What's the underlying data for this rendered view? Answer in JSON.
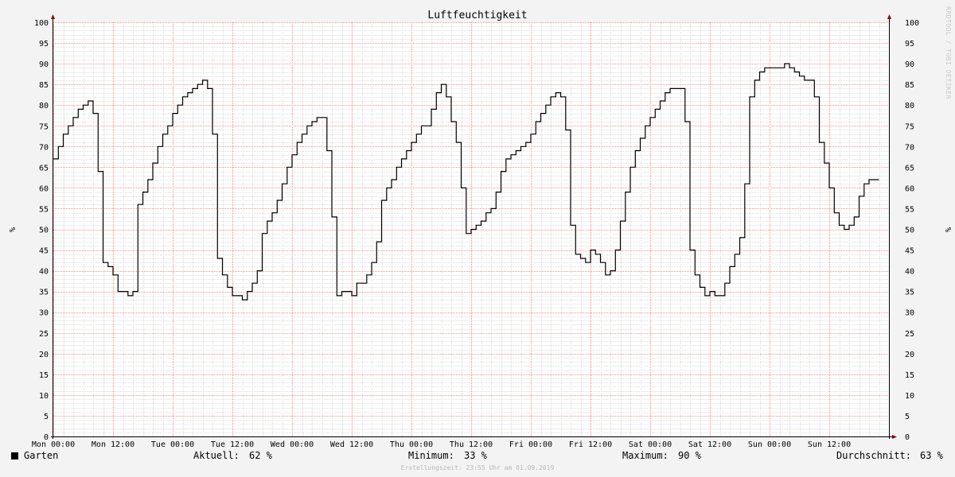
{
  "chart_data": {
    "type": "line",
    "title": "Luftfeuchtigkeit",
    "ylabel": "%",
    "ylim": [
      0,
      100
    ],
    "yticks": [
      0,
      5,
      10,
      15,
      20,
      25,
      30,
      35,
      40,
      45,
      50,
      55,
      60,
      65,
      70,
      75,
      80,
      85,
      90,
      95,
      100
    ],
    "xlim_hours": [
      0,
      168
    ],
    "xtick_labels": [
      "Mon 00:00",
      "Mon 12:00",
      "Tue 00:00",
      "Tue 12:00",
      "Wed 00:00",
      "Wed 12:00",
      "Thu 00:00",
      "Thu 12:00",
      "Fri 00:00",
      "Fri 12:00",
      "Sat 00:00",
      "Sat 12:00",
      "Sun 00:00",
      "Sun 12:00"
    ],
    "grid": true,
    "series": [
      {
        "name": "Garten",
        "color": "#000000",
        "step": "post",
        "x_hours": [
          0,
          1,
          2,
          3,
          4,
          5,
          6,
          7,
          8,
          9,
          10,
          11,
          12,
          13,
          14,
          15,
          16,
          17,
          18,
          19,
          20,
          21,
          22,
          23,
          24,
          25,
          26,
          27,
          28,
          29,
          30,
          31,
          32,
          33,
          34,
          35,
          36,
          37,
          38,
          39,
          40,
          41,
          42,
          43,
          44,
          45,
          46,
          47,
          48,
          49,
          50,
          51,
          52,
          53,
          54,
          55,
          56,
          57,
          58,
          59,
          60,
          61,
          62,
          63,
          64,
          65,
          66,
          67,
          68,
          69,
          70,
          71,
          72,
          73,
          74,
          75,
          76,
          77,
          78,
          79,
          80,
          81,
          82,
          83,
          84,
          85,
          86,
          87,
          88,
          89,
          90,
          91,
          92,
          93,
          94,
          95,
          96,
          97,
          98,
          99,
          100,
          101,
          102,
          103,
          104,
          105,
          106,
          107,
          108,
          109,
          110,
          111,
          112,
          113,
          114,
          115,
          116,
          117,
          118,
          119,
          120,
          121,
          122,
          123,
          124,
          125,
          126,
          127,
          128,
          129,
          130,
          131,
          132,
          133,
          134,
          135,
          136,
          137,
          138,
          139,
          140,
          141,
          142,
          143,
          144,
          145,
          146,
          147,
          148,
          149,
          150,
          151,
          152,
          153,
          154,
          155,
          156,
          157,
          158,
          159,
          160,
          161,
          162,
          163,
          164,
          165,
          166,
          167
        ],
        "values": [
          67,
          70,
          73,
          75,
          77,
          79,
          80,
          81,
          78,
          64,
          42,
          41,
          39,
          35,
          35,
          34,
          35,
          56,
          59,
          62,
          66,
          70,
          73,
          75,
          78,
          80,
          82,
          83,
          84,
          85,
          86,
          84,
          73,
          43,
          39,
          36,
          34,
          34,
          33,
          35,
          37,
          40,
          49,
          52,
          54,
          57,
          61,
          65,
          68,
          71,
          73,
          75,
          76,
          77,
          77,
          69,
          53,
          34,
          35,
          35,
          34,
          37,
          37,
          39,
          42,
          47,
          57,
          60,
          62,
          65,
          67,
          69,
          71,
          73,
          75,
          75,
          79,
          83,
          85,
          82,
          76,
          71,
          60,
          49,
          50,
          51,
          52,
          54,
          55,
          59,
          64,
          67,
          68,
          69,
          70,
          71,
          73,
          76,
          78,
          80,
          82,
          83,
          82,
          74,
          51,
          44,
          43,
          42,
          45,
          44,
          42,
          39,
          40,
          45,
          52,
          59,
          65,
          69,
          72,
          75,
          77,
          79,
          81,
          83,
          84,
          84,
          84,
          76,
          45,
          39,
          36,
          34,
          35,
          34,
          34,
          37,
          41,
          44,
          48,
          61,
          82,
          86,
          88,
          89,
          89,
          89,
          89,
          90,
          89,
          88,
          87,
          86,
          86,
          82,
          71,
          66,
          60,
          54,
          51,
          50,
          51,
          53,
          58,
          61,
          62,
          62
        ]
      }
    ],
    "legend": {
      "name": "Garten",
      "aktuell_label": "Aktuell:",
      "aktuell_value": "62 %",
      "minimum_label": "Minimum:",
      "minimum_value": "33 %",
      "maximum_label": "Maximum:",
      "maximum_value": "90 %",
      "avg_label": "Durchschnitt:",
      "avg_value": "63 %"
    }
  },
  "footer": "Erstellungszeit: 23:55 Uhr am 01.09.2019",
  "watermark": "RRDTOOL / TOBI OETIKER",
  "colors": {
    "background": "#f3f3f3",
    "plot_background": "#ffffff",
    "major_grid": "#ff8f8f",
    "minor_grid": "#dddddd",
    "series": "#000000",
    "axis_arrow": "#8b0000"
  }
}
